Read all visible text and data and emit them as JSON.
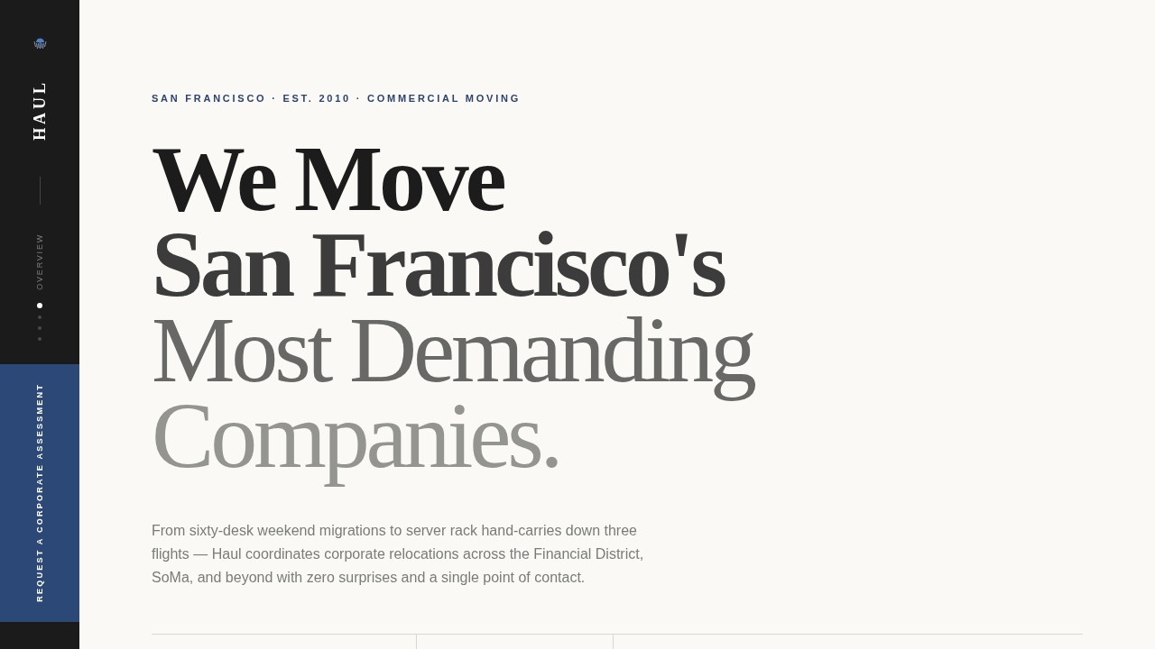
{
  "sidebar": {
    "logo": "HAUL",
    "section_label": "OVERVIEW",
    "nav_dots": [
      {
        "selected": true
      },
      {
        "selected": false
      },
      {
        "selected": false
      },
      {
        "selected": false
      }
    ],
    "cta": "REQUEST A CORPORATE ASSESSMENT"
  },
  "hero": {
    "eyebrow": "SAN FRANCISCO · EST. 2010 · COMMERCIAL MOVING",
    "headline": [
      {
        "text": "We Move",
        "bold": true,
        "color": "#1c1c1c"
      },
      {
        "text": "San Francisco's",
        "bold": true,
        "color": "#3c3c3c"
      },
      {
        "text": "Most Demanding",
        "bold": false,
        "color": "#686866"
      },
      {
        "text": "Companies.",
        "bold": false,
        "color": "#949490"
      }
    ],
    "body": "From sixty-desk weekend migrations to server rack hand-carries down three flights — Haul coordinates corporate relocations across the Financial District, SoMa, and beyond with zero surprises and a single point of contact."
  }
}
